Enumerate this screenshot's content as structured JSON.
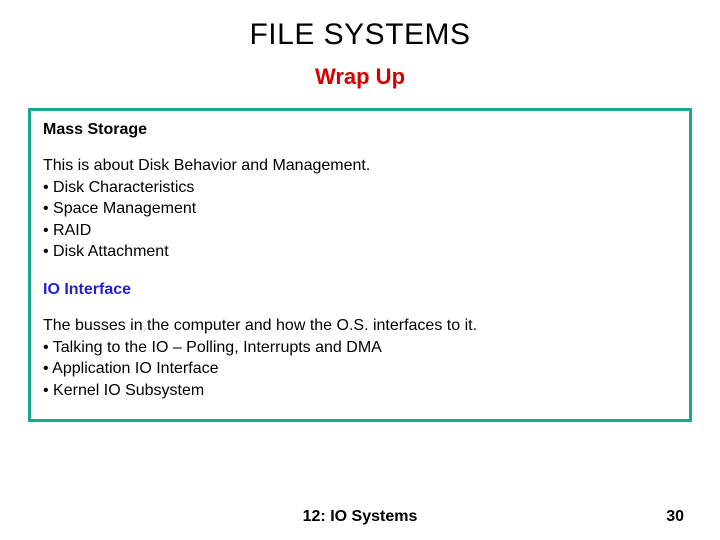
{
  "title": "FILE SYSTEMS",
  "subtitle": "Wrap Up",
  "sections": [
    {
      "heading": "Mass Storage",
      "intro": "This is about Disk Behavior and Management.",
      "bullets": [
        "Disk Characteristics",
        "Space Management",
        "RAID",
        "Disk Attachment"
      ]
    },
    {
      "heading": "IO Interface",
      "intro": "The busses in the computer and how the O.S. interfaces to it.",
      "bullets": [
        "Talking to the IO – Polling, Interrupts and DMA",
        "Application IO Interface",
        "Kernel IO Subsystem"
      ]
    }
  ],
  "footer": {
    "center": "12: IO Systems",
    "page": "30"
  },
  "bullet_prefix": "• "
}
